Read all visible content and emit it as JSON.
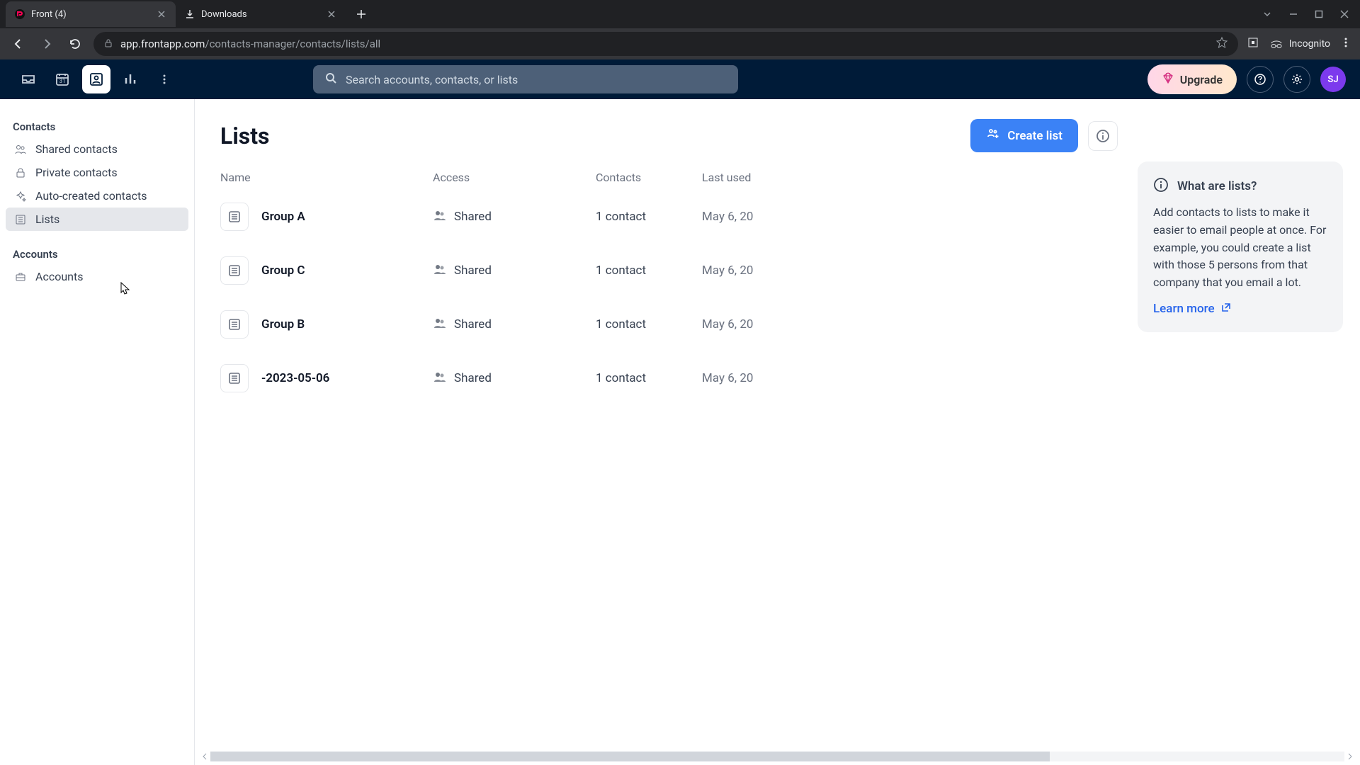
{
  "browser": {
    "tabs": [
      {
        "title": "Front (4)",
        "active": true
      },
      {
        "title": "Downloads",
        "active": false
      }
    ],
    "url_host": "app.frontapp.com",
    "url_path": "/contacts-manager/contacts/lists/all",
    "incognito_label": "Incognito"
  },
  "header": {
    "search_placeholder": "Search accounts, contacts, or lists",
    "upgrade_label": "Upgrade",
    "avatar_initials": "SJ"
  },
  "sidebar": {
    "section_contacts": "Contacts",
    "items_contacts": [
      {
        "label": "Shared contacts"
      },
      {
        "label": "Private contacts"
      },
      {
        "label": "Auto-created contacts"
      },
      {
        "label": "Lists"
      }
    ],
    "section_accounts": "Accounts",
    "items_accounts": [
      {
        "label": "Accounts"
      }
    ]
  },
  "page": {
    "title": "Lists",
    "create_label": "Create list",
    "columns": {
      "name": "Name",
      "access": "Access",
      "contacts": "Contacts",
      "last_used": "Last used"
    },
    "rows": [
      {
        "name": "Group A",
        "access": "Shared",
        "contacts": "1 contact",
        "last_used": "May 6, 20"
      },
      {
        "name": "Group C",
        "access": "Shared",
        "contacts": "1 contact",
        "last_used": "May 6, 20"
      },
      {
        "name": "Group B",
        "access": "Shared",
        "contacts": "1 contact",
        "last_used": "May 6, 20"
      },
      {
        "name": "-2023-05-06",
        "access": "Shared",
        "contacts": "1 contact",
        "last_used": "May 6, 20"
      }
    ]
  },
  "hint": {
    "title": "What are lists?",
    "body": "Add contacts to lists to make it easier to email people at once. For example, you could create a list with those 5 persons from that company that you email a lot.",
    "learn_more": "Learn more"
  }
}
